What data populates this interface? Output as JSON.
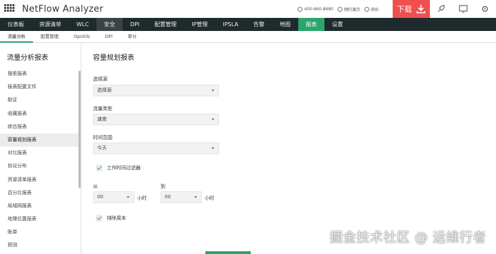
{
  "app": {
    "title": "NetFlow Analyzer"
  },
  "topbar": {
    "phone": "400-660-8680",
    "demo": "预约演示",
    "quote": "询价",
    "download_label": "下载"
  },
  "mainnav": {
    "items": [
      "仪表板",
      "资源清单",
      "WLC",
      "安全",
      "DPI",
      "配置管理",
      "IP管理",
      "IPSLA",
      "告警",
      "地图",
      "报表",
      "设置"
    ]
  },
  "subnav": {
    "items": [
      "流量分析",
      "配置管理",
      "OpUtils",
      "DPI",
      "审计"
    ]
  },
  "sidebar": {
    "title": "流量分析报表",
    "items": [
      "搜索报表",
      "报表配置文件",
      "取证",
      "收藏报表",
      "综合报表",
      "容量规划报表",
      "对比报表",
      "协议分布",
      "资源清单报表",
      "百分比报表",
      "局域网报表",
      "地理位置报表",
      "账单",
      "预测"
    ]
  },
  "content": {
    "title": "容量规划报表",
    "source": {
      "label": "选择源",
      "value": "选择源"
    },
    "traffic_type": {
      "label": "流量类型",
      "value": "速度"
    },
    "time_range": {
      "label": "时间范围",
      "value": "今天"
    },
    "work_hours_filter": "工作时间过滤器",
    "from": {
      "label": "从",
      "value": "00",
      "unit": "小时"
    },
    "to": {
      "label": "到",
      "value": "00",
      "unit": "小时"
    },
    "exclude_weekend": "排除周末"
  },
  "watermark": "掘金技术社区 @ 运维行者",
  "colors": {
    "accent": "#2aa56c",
    "nav_bg": "#1f2a2c",
    "download": "#ef4f4f"
  }
}
